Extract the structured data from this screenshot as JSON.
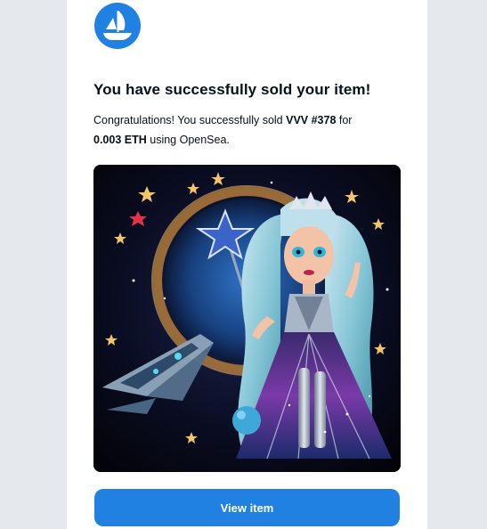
{
  "email": {
    "logo_icon": "opensea-ship-logo-icon",
    "title": "You have successfully sold your item!",
    "message": {
      "intro": "Congratulations! You successfully sold ",
      "item_name": "VVV #378",
      "for_text": " for",
      "price": "0.003 ETH",
      "outro": " using OpenSea."
    },
    "image_icon": "nft-artwork-image",
    "cta_label": "View item"
  },
  "colors": {
    "background": "#e5e8ec",
    "card": "#ffffff",
    "brand_blue": "#2081e2",
    "text": "#04111d"
  }
}
